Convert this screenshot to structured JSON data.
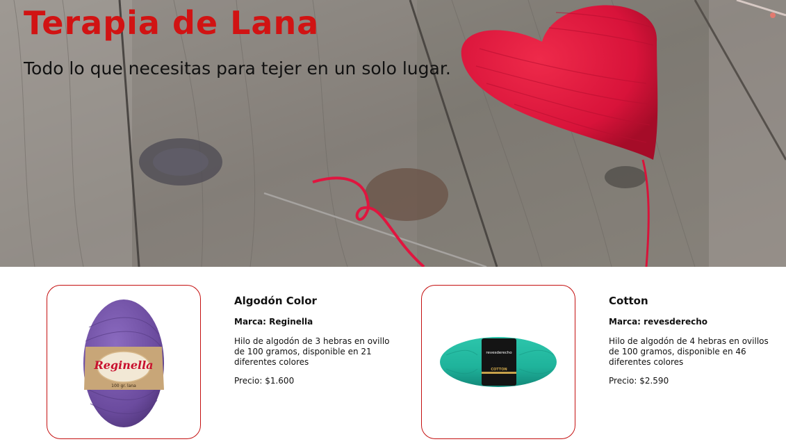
{
  "hero": {
    "title": "Terapia de Lana",
    "subtitle": "Todo lo que necesitas para tejer en un solo lugar.",
    "image": "knitted-red-heart-on-wooden-table"
  },
  "colors": {
    "title": "#d11313",
    "card_border": "#c40f0f",
    "yarn_purple": "#6b4b9e",
    "yarn_teal": "#1fb39b"
  },
  "products": [
    {
      "name": "Algodón Color",
      "brand": "Marca: Reginella",
      "description": "Hilo de algodón de 3 hebras en ovillo de 100 gramos, disponible en 21 diferentes colores",
      "price": "Precio: $1.600",
      "image": "purple-yarn-ball",
      "label_text": "Reginella",
      "label_small": "100 gr. lana"
    },
    {
      "name": "Cotton",
      "brand": "Marca: revesderecho",
      "description": "Hilo de algodón de 4 hebras en ovillos de 100 gramos, disponible en 46 diferentes colores",
      "price": "Precio: $2.590",
      "image": "teal-yarn-skein",
      "label_text": "revesderecho",
      "label_small": "COTTON"
    }
  ]
}
